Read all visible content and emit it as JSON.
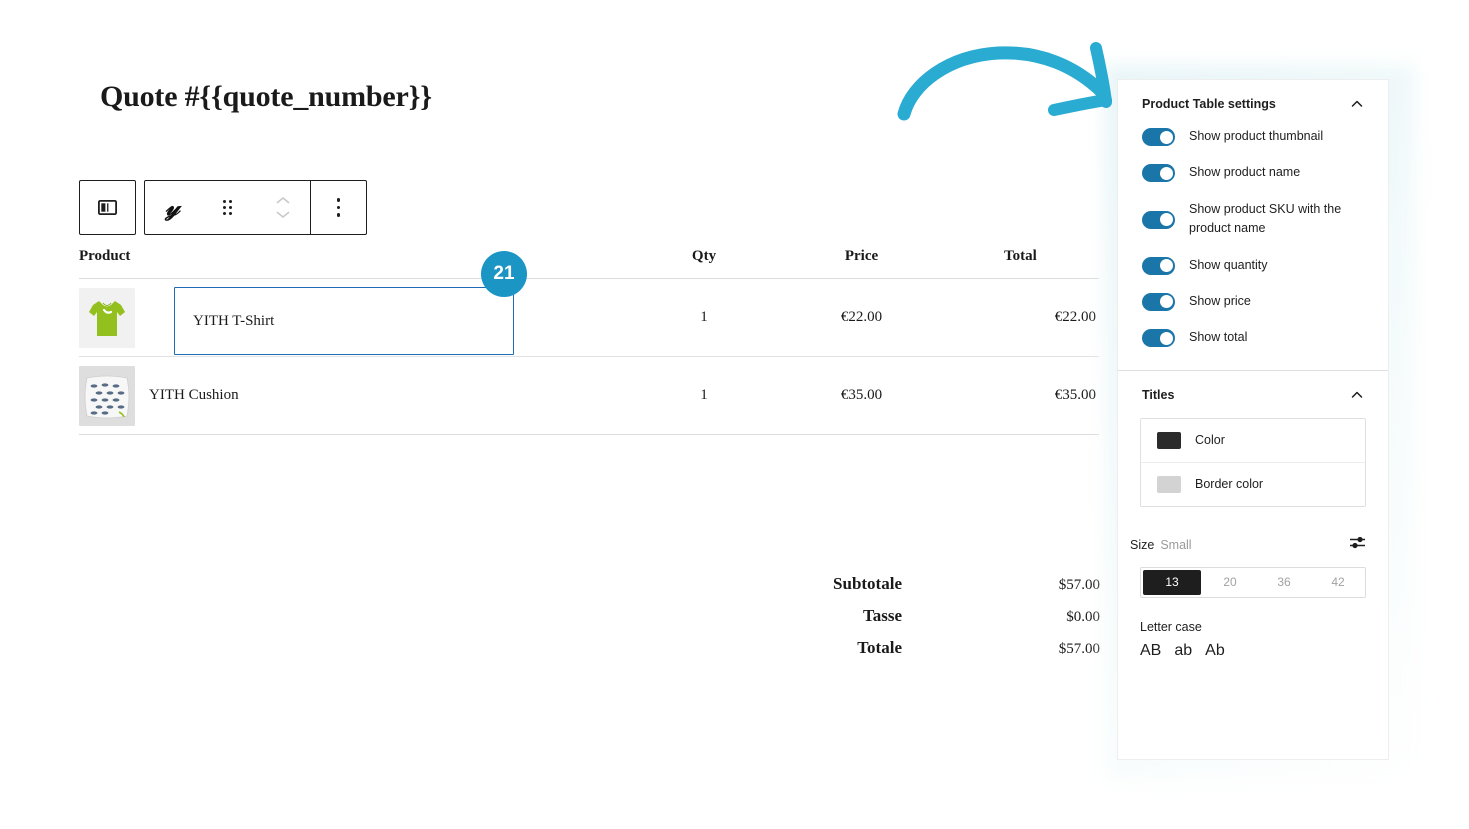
{
  "document": {
    "title": "Quote #{{quote_number}}"
  },
  "block_toolbar": {
    "columns_button_name": "columns-layout",
    "brand_mark": "𝓎",
    "buttons": [
      "columns-icon",
      "yith-logo-icon",
      "drag-handle-icon",
      "move-up-down-icon",
      "more-options-icon"
    ]
  },
  "step_badge": {
    "number": "21"
  },
  "products_table": {
    "columns": [
      "Product",
      "Qty",
      "Price",
      "Total"
    ],
    "rows": [
      {
        "thumbnail": "green-tshirt-thumbnail",
        "name": "YITH T-Shirt",
        "qty": "1",
        "price": "€22.00",
        "total": "€22.00",
        "selected": true
      },
      {
        "thumbnail": "patterned-cushion-thumbnail",
        "name": "YITH Cushion",
        "qty": "1",
        "price": "€35.00",
        "total": "€35.00",
        "selected": false
      }
    ]
  },
  "totals": [
    {
      "label": "Subtotale",
      "value": "$57.00"
    },
    {
      "label": "Tasse",
      "value": "$0.00"
    },
    {
      "label": "Totale",
      "value": "$57.00"
    }
  ],
  "sidebar": {
    "product_table_settings": {
      "title": "Product Table settings",
      "toggles": [
        {
          "label": "Show product thumbnail",
          "on": true
        },
        {
          "label": "Show product name",
          "on": true
        },
        {
          "label": "Show product SKU with the product name",
          "on": true
        },
        {
          "label": "Show quantity",
          "on": true
        },
        {
          "label": "Show price",
          "on": true
        },
        {
          "label": "Show total",
          "on": true
        }
      ]
    },
    "titles": {
      "title": "Titles",
      "colors": [
        {
          "label": "Color",
          "swatch": "#2b2b2b"
        },
        {
          "label": "Border color",
          "swatch": "#d3d3d3"
        }
      ],
      "size": {
        "label": "Size",
        "value": "Small",
        "options": [
          "13",
          "20",
          "36",
          "42"
        ],
        "selected": "13"
      },
      "letter_case": {
        "label": "Letter case",
        "options": [
          "AB",
          "ab",
          "Ab"
        ]
      }
    }
  },
  "annotation": {
    "arrow_color": "#2aabd2"
  },
  "colors": {
    "accent_blue": "#1b95c4",
    "toggle_blue": "#1a76a8",
    "selection_blue": "#1e6bb8"
  }
}
